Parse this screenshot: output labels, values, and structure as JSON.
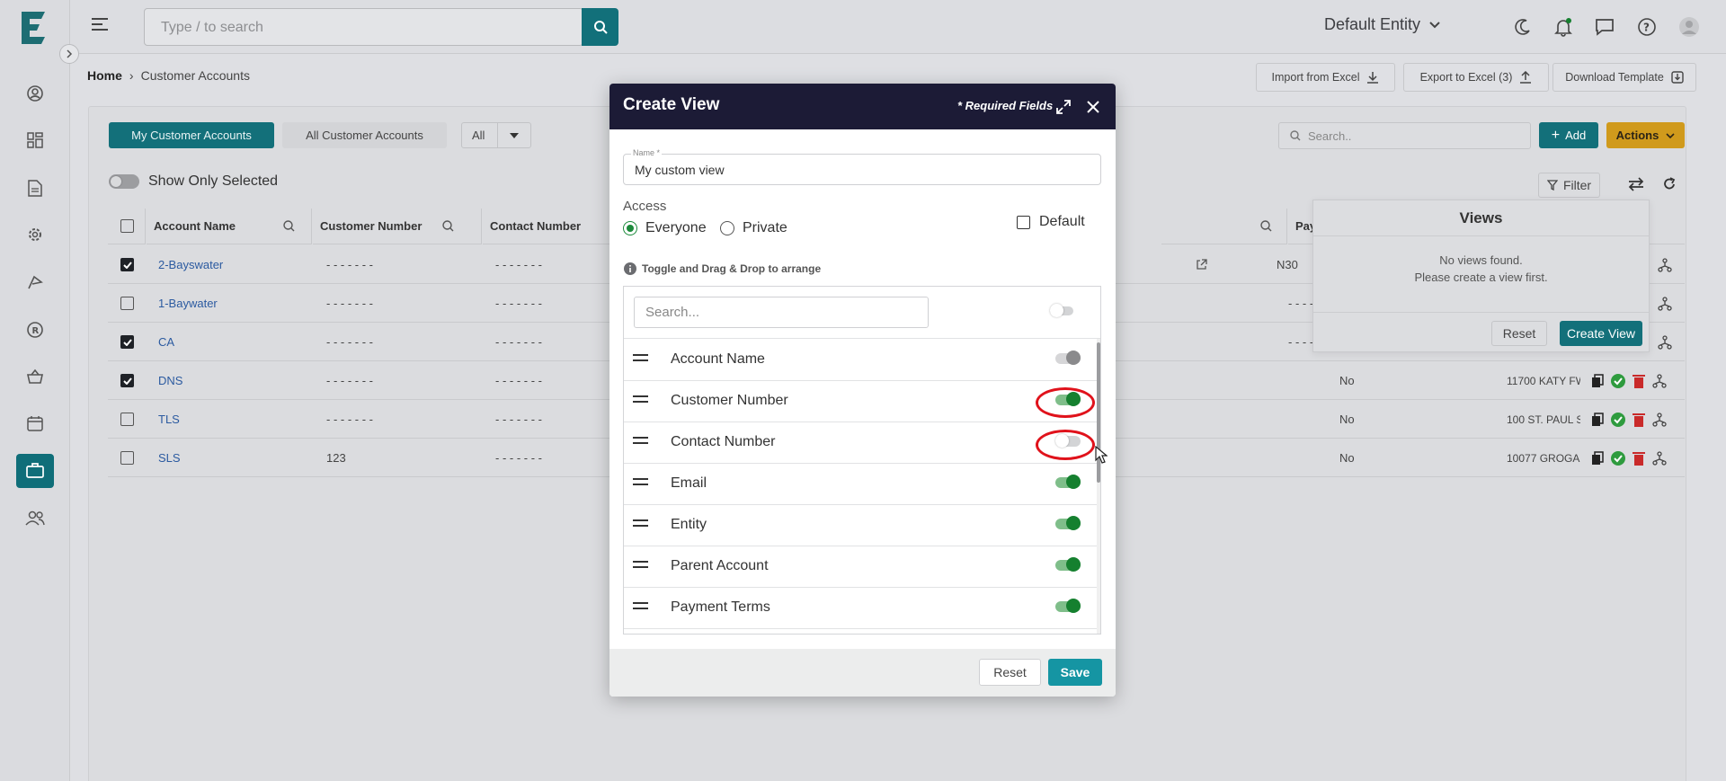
{
  "header": {
    "search_placeholder": "Type / to search",
    "entity": "Default Entity"
  },
  "breadcrumb": {
    "home": "Home",
    "sep": "›",
    "current": "Customer Accounts"
  },
  "top_actions": {
    "import": "Import from Excel",
    "export": "Export to Excel (3)",
    "download": "Download Template"
  },
  "tabs": {
    "my": "My Customer Accounts",
    "all": "All Customer Accounts",
    "filter_select": "All"
  },
  "toolbar": {
    "search_placeholder": "Search..",
    "add": "Add",
    "actions": "Actions",
    "filter": "Filter"
  },
  "show_only_selected": "Show Only Selected",
  "table": {
    "headers": [
      "Account Name",
      "Customer Number",
      "Contact Number",
      "Payment Terms"
    ],
    "rows": [
      {
        "name": "2-Bayswater",
        "customer_number": "- - - - - - -",
        "contact_number": "- - - - - - -",
        "payment_terms": "N30",
        "col_a": "",
        "address": "",
        "checked": true
      },
      {
        "name": "1-Baywater",
        "customer_number": "- - - - - - -",
        "contact_number": "- - - - - - -",
        "payment_terms": "- - - - - - -",
        "col_a": "",
        "address": "",
        "checked": false
      },
      {
        "name": "CA",
        "customer_number": "- - - - - - -",
        "contact_number": "- - - - - - -",
        "payment_terms": "- - - - - - -",
        "col_a": "",
        "address": "",
        "checked": true
      },
      {
        "name": "DNS",
        "customer_number": "- - - - - - -",
        "contact_number": "- - - - - - -",
        "payment_terms": "- - - - - - -",
        "col_a": "No",
        "address": "11700 KATY FW",
        "checked": true
      },
      {
        "name": "TLS",
        "customer_number": "- - - - - - -",
        "contact_number": "- - - - - - -",
        "payment_terms": "- - - - - - -",
        "col_a": "No",
        "address": "100 ST. PAUL S",
        "checked": false
      },
      {
        "name": "SLS",
        "customer_number": "123",
        "contact_number": "- - - - - - -",
        "payment_terms": "- - - - - - -",
        "col_a": "No",
        "address": "10077 GROGAN",
        "checked": false
      }
    ]
  },
  "views_panel": {
    "title": "Views",
    "empty_line1": "No views found.",
    "empty_line2": "Please create a view first.",
    "reset": "Reset",
    "create": "Create View"
  },
  "modal": {
    "title": "Create View",
    "required": "* Required Fields",
    "name_label": "Name *",
    "name_value": "My custom view",
    "access_label": "Access",
    "access_everyone": "Everyone",
    "access_private": "Private",
    "default_label": "Default",
    "hint": "Toggle and Drag & Drop to arrange",
    "search_placeholder": "Search...",
    "columns": [
      {
        "label": "Account Name",
        "state": "disabled"
      },
      {
        "label": "Customer Number",
        "state": "on"
      },
      {
        "label": "Contact Number",
        "state": "off"
      },
      {
        "label": "Email",
        "state": "on"
      },
      {
        "label": "Entity",
        "state": "on"
      },
      {
        "label": "Parent Account",
        "state": "on"
      },
      {
        "label": "Payment Terms",
        "state": "on"
      }
    ],
    "reset": "Reset",
    "save": "Save"
  },
  "colors": {
    "teal": "#12707a",
    "modal_header": "#1c1b36",
    "toggle_on": "#15802f",
    "highlight": "#e0121b",
    "actions": "#d09a1c"
  }
}
